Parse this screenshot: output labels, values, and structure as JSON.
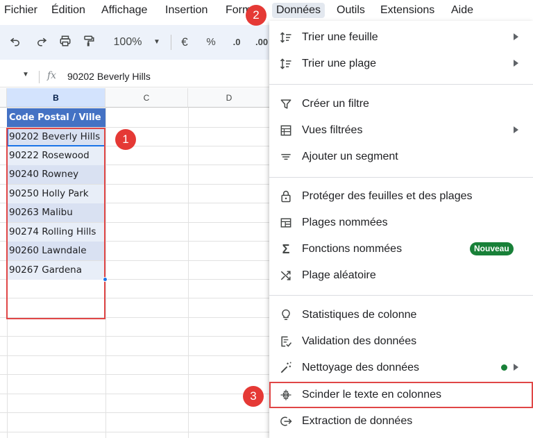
{
  "menubar": {
    "items": [
      "Fichier",
      "Édition",
      "Affichage",
      "Insertion",
      "Format",
      "Données",
      "Outils",
      "Extensions",
      "Aide"
    ]
  },
  "toolbar": {
    "undo_icon": "undo-icon",
    "redo_icon": "redo-icon",
    "print_icon": "print-icon",
    "paint_format_icon": "paint-format-icon",
    "zoom": "100%",
    "currency": "€",
    "percent": "%",
    "decrease_decimals": ".0",
    "increase_decimals": ".00"
  },
  "formula_bar": {
    "fx": "fx",
    "value": "90202 Beverly Hills"
  },
  "grid": {
    "columns": [
      "B",
      "C",
      "D"
    ],
    "header": "Code Postal / Ville",
    "rows": [
      "90202 Beverly Hills",
      "90222 Rosewood",
      "90240 Rowney",
      "90250 Holly Park",
      "90263 Malibu",
      "90274 Rolling Hills",
      "90260 Lawndale",
      "90267 Gardena"
    ]
  },
  "badges": [
    "1",
    "2",
    "3"
  ],
  "dropdown": {
    "items": [
      {
        "label": "Trier une feuille",
        "icon": "sort-icon",
        "submenu": true
      },
      {
        "label": "Trier une plage",
        "icon": "sort-icon",
        "submenu": true
      },
      {
        "label": "Créer un filtre",
        "icon": "filter-icon",
        "submenu": false
      },
      {
        "label": "Vues filtrées",
        "icon": "filter-views-icon",
        "submenu": true
      },
      {
        "label": "Ajouter un segment",
        "icon": "slicer-icon",
        "submenu": false
      },
      {
        "label": "Protéger des feuilles et des plages",
        "icon": "lock-icon",
        "submenu": false
      },
      {
        "label": "Plages nommées",
        "icon": "named-ranges-icon",
        "submenu": false
      },
      {
        "label": "Fonctions nommées",
        "icon": "sigma-icon",
        "submenu": false,
        "badge": "Nouveau"
      },
      {
        "label": "Plage aléatoire",
        "icon": "shuffle-icon",
        "submenu": false
      },
      {
        "label": "Statistiques de colonne",
        "icon": "lightbulb-icon",
        "submenu": false
      },
      {
        "label": "Validation des données",
        "icon": "data-validation-icon",
        "submenu": false
      },
      {
        "label": "Nettoyage des données",
        "icon": "magic-wand-icon",
        "submenu": true,
        "dot": true
      },
      {
        "label": "Scinder le texte en colonnes",
        "icon": "split-columns-icon",
        "submenu": false
      },
      {
        "label": "Extraction de données",
        "icon": "data-extraction-icon",
        "submenu": false
      }
    ]
  },
  "colors": {
    "header_fill": "#4472c4",
    "row_fill_a": "#d9e1f2",
    "row_fill_b": "#e8eef8",
    "highlight": "#e04646",
    "badge": "#e53935",
    "new_badge": "#188038"
  }
}
